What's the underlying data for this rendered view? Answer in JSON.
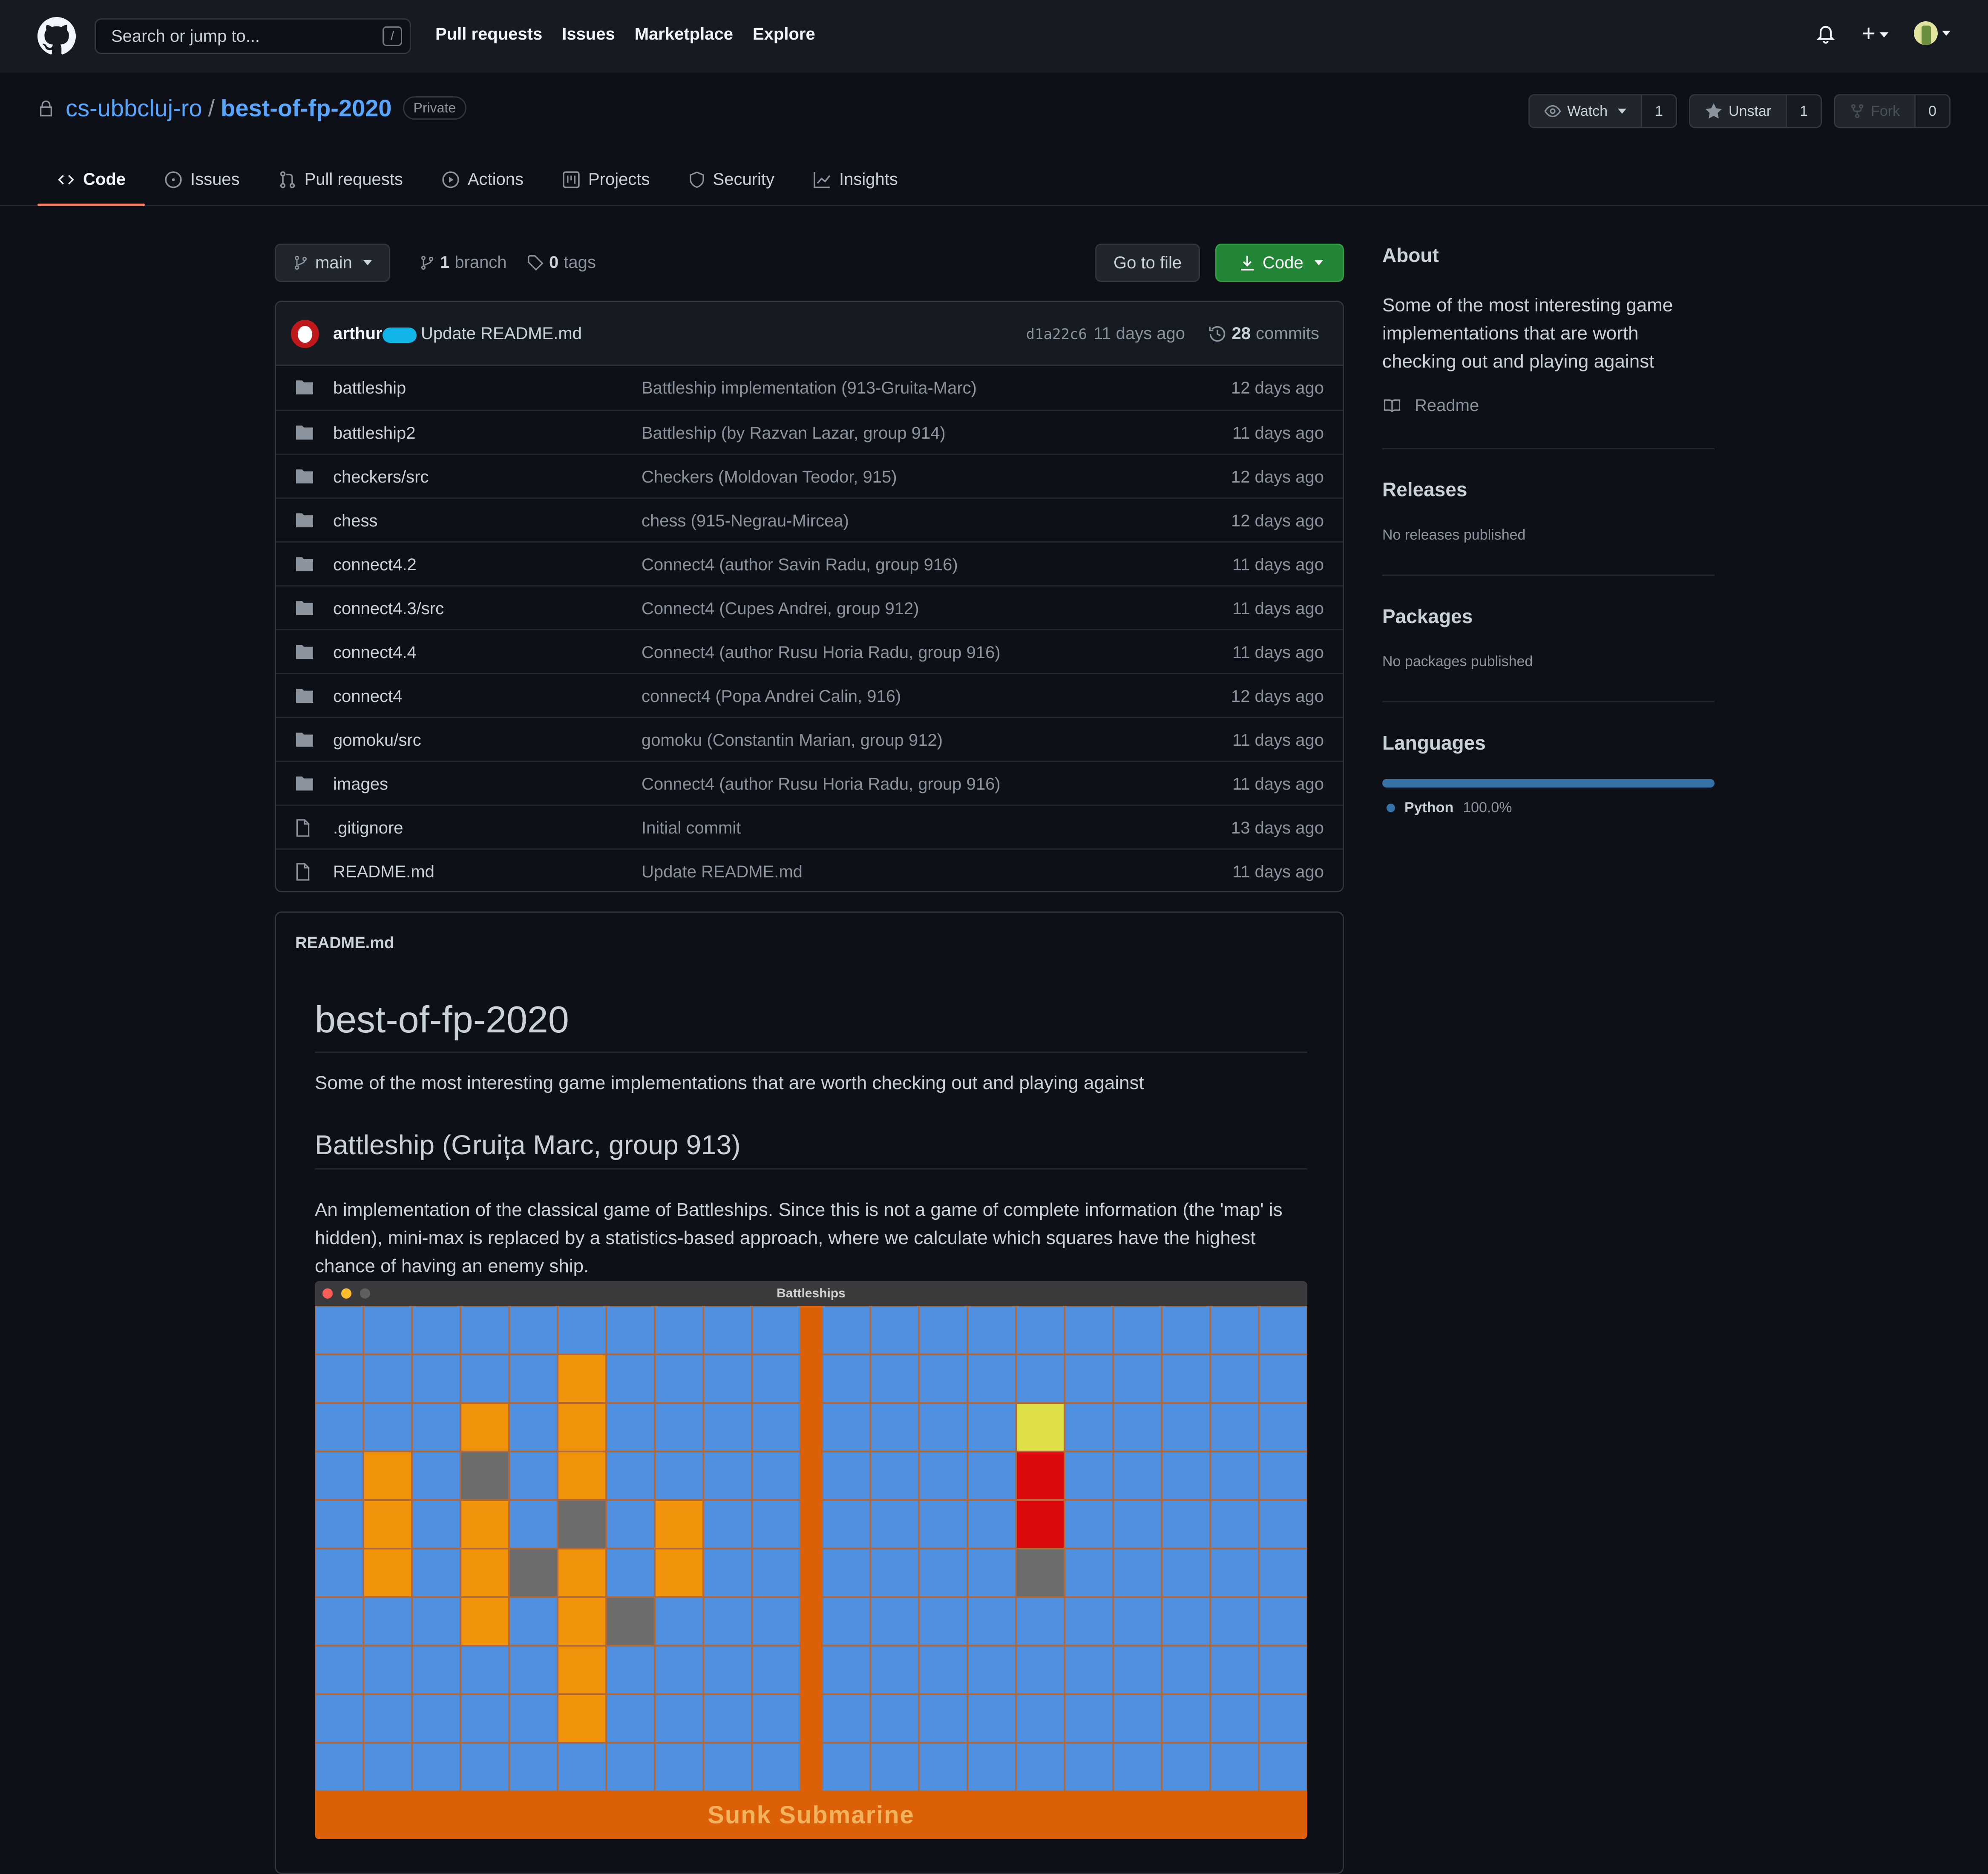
{
  "topbar": {
    "search_placeholder": "Search or jump to...",
    "search_shortcut": "/",
    "nav": [
      "Pull requests",
      "Issues",
      "Marketplace",
      "Explore"
    ]
  },
  "repo": {
    "owner": "cs-ubbcluj-ro",
    "separator": "/",
    "name": "best-of-fp-2020",
    "visibility": "Private",
    "watch_label": "Watch",
    "watch_count": "1",
    "star_label": "Unstar",
    "star_count": "1",
    "fork_label": "Fork",
    "fork_count": "0",
    "tabs": [
      "Code",
      "Issues",
      "Pull requests",
      "Actions",
      "Projects",
      "Security",
      "Insights"
    ]
  },
  "branchbar": {
    "branch": "main",
    "branches_count": "1",
    "branches_label": "branch",
    "tags_count": "0",
    "tags_label": "tags",
    "goto_file": "Go to file",
    "code_button": "Code"
  },
  "commit": {
    "user": "arthur",
    "message": "Update README.md",
    "sha": "d1a22c6",
    "when": "11 days ago",
    "commits_count": "28",
    "commits_label": "commits"
  },
  "files": [
    {
      "type": "dir",
      "name": "battleship",
      "message": "Battleship implementation (913-Gruita-Marc)",
      "age": "12 days ago"
    },
    {
      "type": "dir",
      "name": "battleship2",
      "message": "Battleship (by Razvan Lazar, group 914)",
      "age": "11 days ago"
    },
    {
      "type": "dir",
      "name": "checkers/src",
      "message": "Checkers (Moldovan Teodor, 915)",
      "age": "12 days ago"
    },
    {
      "type": "dir",
      "name": "chess",
      "message": "chess (915-Negrau-Mircea)",
      "age": "12 days ago"
    },
    {
      "type": "dir",
      "name": "connect4.2",
      "message": "Connect4 (author Savin Radu, group 916)",
      "age": "11 days ago"
    },
    {
      "type": "dir",
      "name": "connect4.3/src",
      "message": "Connect4 (Cupes Andrei, group 912)",
      "age": "11 days ago"
    },
    {
      "type": "dir",
      "name": "connect4.4",
      "message": "Connect4 (author Rusu Horia Radu, group 916)",
      "age": "11 days ago"
    },
    {
      "type": "dir",
      "name": "connect4",
      "message": "connect4 (Popa Andrei Calin, 916)",
      "age": "12 days ago"
    },
    {
      "type": "dir",
      "name": "gomoku/src",
      "message": "gomoku (Constantin Marian, group 912)",
      "age": "11 days ago"
    },
    {
      "type": "dir",
      "name": "images",
      "message": "Connect4 (author Rusu Horia Radu, group 916)",
      "age": "11 days ago"
    },
    {
      "type": "file",
      "name": ".gitignore",
      "message": "Initial commit",
      "age": "13 days ago"
    },
    {
      "type": "file",
      "name": "README.md",
      "message": "Update README.md",
      "age": "11 days ago"
    }
  ],
  "readme": {
    "header": "README.md",
    "title": "best-of-fp-2020",
    "intro": "Some of the most interesting game implementations that are worth checking out and playing against",
    "section_title": "Battleship (Gruița Marc, group 913)",
    "section_text": "An implementation of the classical game of Battleships. Since this is not a game of complete information (the 'map' is hidden), mini-max is replaced by a statistics-based approach, where we calculate which squares have the highest chance of having an enemy ship.",
    "game": {
      "window_title": "Battleships",
      "status": "Sunk Submarine",
      "left_grid": [
        "..........",
        ".....o....",
        "...o.o....",
        ".o.g.o....",
        ".o.o.g.o..",
        ".o.ogo.o..",
        "...o.og...",
        ".....o....",
        ".....o....",
        ".........."
      ],
      "right_grid": [
        "..........",
        "..........",
        "....y.....",
        "....r.....",
        "....r.....",
        "....g.....",
        "..........",
        "..........",
        "..........",
        ".........."
      ]
    }
  },
  "sidebar": {
    "about_title": "About",
    "about_text": "Some of the most interesting game implementations that are worth checking out and playing against",
    "readme_link": "Readme",
    "releases_title": "Releases",
    "releases_text": "No releases published",
    "packages_title": "Packages",
    "packages_text": "No packages published",
    "languages_title": "Languages",
    "language_name": "Python",
    "language_pct": "100.0%",
    "language_color": "#3572A5"
  }
}
